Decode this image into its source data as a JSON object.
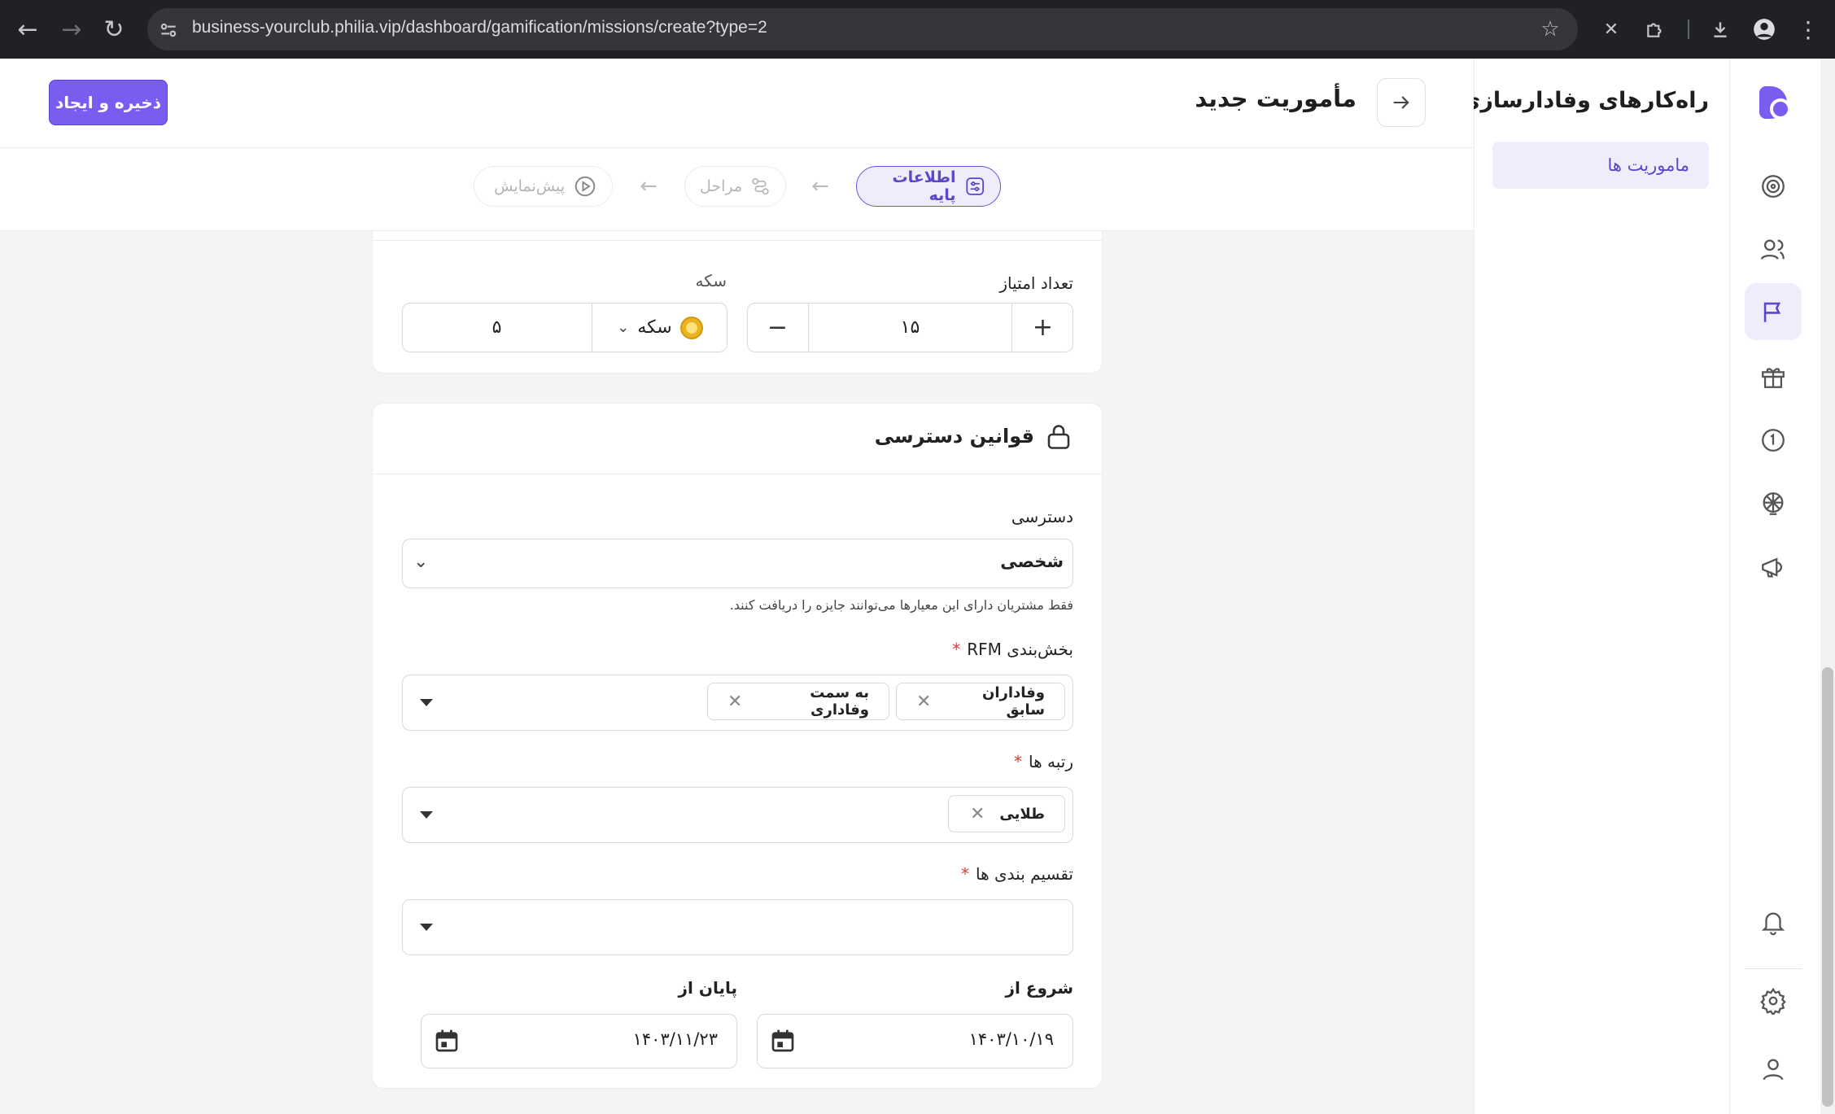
{
  "browser": {
    "url": "business-yourclub.philia.vip/dashboard/gamification/missions/create?type=2"
  },
  "sidebar": {
    "title": "راه‌کارهای وفادارسازی",
    "items": [
      {
        "label": "ماموریت ها"
      }
    ]
  },
  "header": {
    "title": "مأموریت جدید",
    "save_label": "ذخیره و ایجاد"
  },
  "steps": [
    {
      "label": "اطلاعات پایه",
      "state": "active"
    },
    {
      "label": "مراحل",
      "state": "inactive"
    },
    {
      "label": "پیش‌نمایش",
      "state": "inactive"
    }
  ],
  "reward": {
    "points_label": "تعداد امتیاز",
    "points_value": "۱۵",
    "coin_label": "سکه",
    "coin_type": "سکه",
    "coin_amount": "۵"
  },
  "access": {
    "section_title": "قوانین دسترسی",
    "access_label": "دسترسی",
    "access_value": "شخصی",
    "access_hint": "فقط مشتریان دارای این معیارها می‌توانند جایزه را دریافت کنند.",
    "rfm_label": "بخش‌بندی RFM",
    "rfm_tags": [
      "وفاداران سابق",
      "به سمت وفاداری"
    ],
    "ranks_label": "رتبه ها",
    "ranks_tags": [
      "طلایی"
    ],
    "categories_label": "تقسیم بندی ها",
    "start_label": "شروع از",
    "start_value": "۱۴۰۳/۱۰/۱۹",
    "end_label": "پایان از",
    "end_value": "۱۴۰۳/۱۱/۲۳",
    "required_mark": "*"
  },
  "colors": {
    "accent": "#7b5cf0",
    "accent_soft": "#efecfb",
    "required": "#e53935"
  }
}
